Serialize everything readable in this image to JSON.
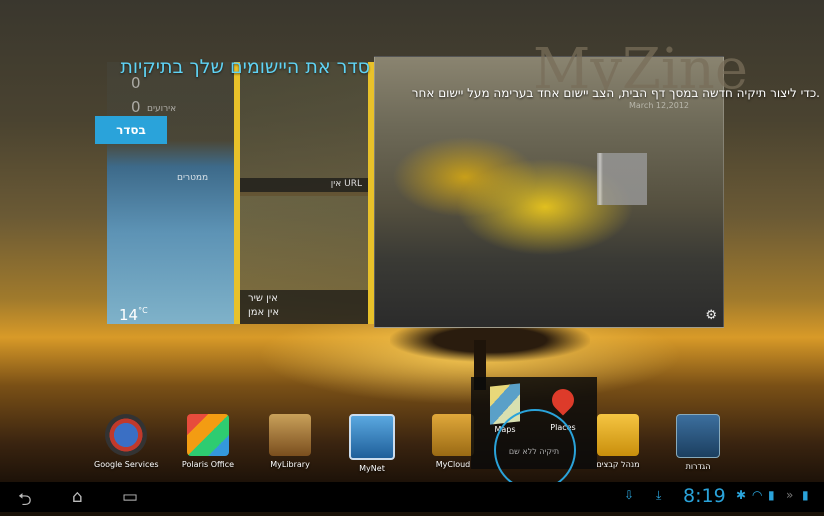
{
  "overlay": {
    "title": "סדר את היישומים שלך בתיקיות",
    "description": "כדי ליצור תיקיה חדשה במסך דף הבית, הצב יישום אחד בערימה מעל יישום אחר.",
    "organize_button": "בסדר"
  },
  "widgets": {
    "weather": {
      "num1": "0",
      "num2": "0",
      "label1": "אירועים",
      "city": "ממטרים",
      "temperature": "14",
      "unit": "°C"
    },
    "browser": {
      "url_label": "אין URL"
    },
    "music": {
      "line1": "אין שיר",
      "line2": "אין אמן"
    },
    "magazine": {
      "title": "MyZine",
      "date": "March 12,2012"
    }
  },
  "dock": {
    "apps": [
      {
        "label": "Google Services"
      },
      {
        "label": "Polaris Office"
      },
      {
        "label": "MyLibrary"
      },
      {
        "label": "MyNet"
      },
      {
        "label": "MyCloud"
      },
      {
        "label": "מנהל קבצים"
      },
      {
        "label": "הגדרות"
      }
    ]
  },
  "folder": {
    "items": [
      {
        "label": "Maps"
      },
      {
        "label": "Places"
      }
    ],
    "name": "תיקיה ללא שם"
  },
  "statusbar": {
    "time": "8:19"
  },
  "colors": {
    "accent": "#2aa3da",
    "widget_divider": "#e8c12a"
  }
}
